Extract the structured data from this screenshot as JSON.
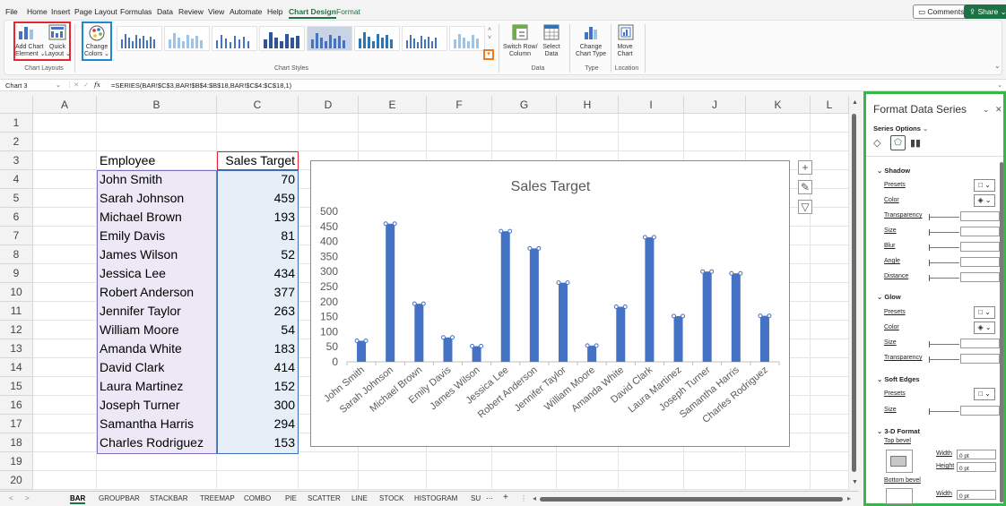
{
  "menu": {
    "items": [
      "File",
      "Home",
      "Insert",
      "Page Layout",
      "Formulas",
      "Data",
      "Review",
      "View",
      "Automate",
      "Help",
      "Chart Design",
      "Format"
    ],
    "active": "Chart Design",
    "comments": "Comments",
    "share": "Share"
  },
  "ribbon": {
    "add_chart_element": [
      "Add Chart",
      "Element"
    ],
    "quick_layout": [
      "Quick",
      "Layout"
    ],
    "change_colors": [
      "Change",
      "Colors"
    ],
    "chart_layouts": "Chart Layouts",
    "chart_styles": "Chart Styles",
    "switch_row_col": [
      "Switch Row/",
      "Column"
    ],
    "select_data": [
      "Select",
      "Data"
    ],
    "data_group": "Data",
    "change_chart_type": [
      "Change",
      "Chart Type"
    ],
    "type_group": "Type",
    "move_chart": [
      "Move",
      "Chart"
    ],
    "location_group": "Location"
  },
  "formula_bar": {
    "name_box": "Chart 3",
    "fx": "fx",
    "formula": "=SERIES(BAR!$C$3,BAR!$B$4:$B$18,BAR!$C$4:$C$18,1)"
  },
  "grid": {
    "columns": [
      "A",
      "B",
      "C",
      "D",
      "E",
      "F",
      "G",
      "H",
      "I",
      "J",
      "K",
      "L"
    ],
    "rows": [
      "1",
      "2",
      "3",
      "4",
      "5",
      "6",
      "7",
      "8",
      "9",
      "10",
      "11",
      "12",
      "13",
      "14",
      "15",
      "16",
      "17",
      "18",
      "19",
      "20"
    ],
    "header_employee": "Employee",
    "header_sales": "Sales Target",
    "employees": [
      "John Smith",
      "Sarah Johnson",
      "Michael Brown",
      "Emily Davis",
      "James Wilson",
      "Jessica Lee",
      "Robert Anderson",
      "Jennifer Taylor",
      "William Moore",
      "Amanda White",
      "David Clark",
      "Laura Martinez",
      "Joseph Turner",
      "Samantha Harris",
      "Charles Rodriguez"
    ],
    "sales": [
      "70",
      "459",
      "193",
      "81",
      "52",
      "434",
      "377",
      "263",
      "54",
      "183",
      "414",
      "152",
      "300",
      "294",
      "153"
    ]
  },
  "chart_data": {
    "type": "bar",
    "title": "Sales Target",
    "categories": [
      "John Smith",
      "Sarah Johnson",
      "Michael Brown",
      "Emily Davis",
      "James Wilson",
      "Jessica Lee",
      "Robert Anderson",
      "Jennifer Taylor",
      "William Moore",
      "Amanda White",
      "David Clark",
      "Laura Martinez",
      "Joseph Turner",
      "Samantha Harris",
      "Charles Rodriguez"
    ],
    "values": [
      70,
      459,
      193,
      81,
      52,
      434,
      377,
      263,
      54,
      183,
      414,
      152,
      300,
      294,
      153
    ],
    "ylim": [
      0,
      500
    ],
    "yticks": [
      "0",
      "50",
      "100",
      "150",
      "200",
      "250",
      "300",
      "350",
      "400",
      "450",
      "500"
    ],
    "bar_color": "#4472c4",
    "grid": false
  },
  "sheet_tabs": {
    "tabs": [
      "BAR",
      "GROUPBAR",
      "STACKBAR",
      "TREEMAP",
      "COMBO",
      "PIE",
      "SCATTER",
      "LINE",
      "STOCK",
      "HISTOGRAM",
      "SU"
    ],
    "active": "BAR",
    "add": "+"
  },
  "pane": {
    "title": "Format Data Series",
    "series_options": "Series Options",
    "shadow": "Shadow",
    "shadow_fields": [
      "Presets",
      "Color",
      "Transparency",
      "Size",
      "Blur",
      "Angle",
      "Distance"
    ],
    "glow": "Glow",
    "glow_fields": [
      "Presets",
      "Color",
      "Size",
      "Transparency"
    ],
    "soft_edges": "Soft Edges",
    "soft_fields": [
      "Presets",
      "Size"
    ],
    "format_3d": "3-D Format",
    "top_bevel": "Top bevel",
    "bottom_bevel": "Bottom bevel",
    "width_label": "Width",
    "height_label": "Height",
    "pt_value": "0 pt"
  }
}
